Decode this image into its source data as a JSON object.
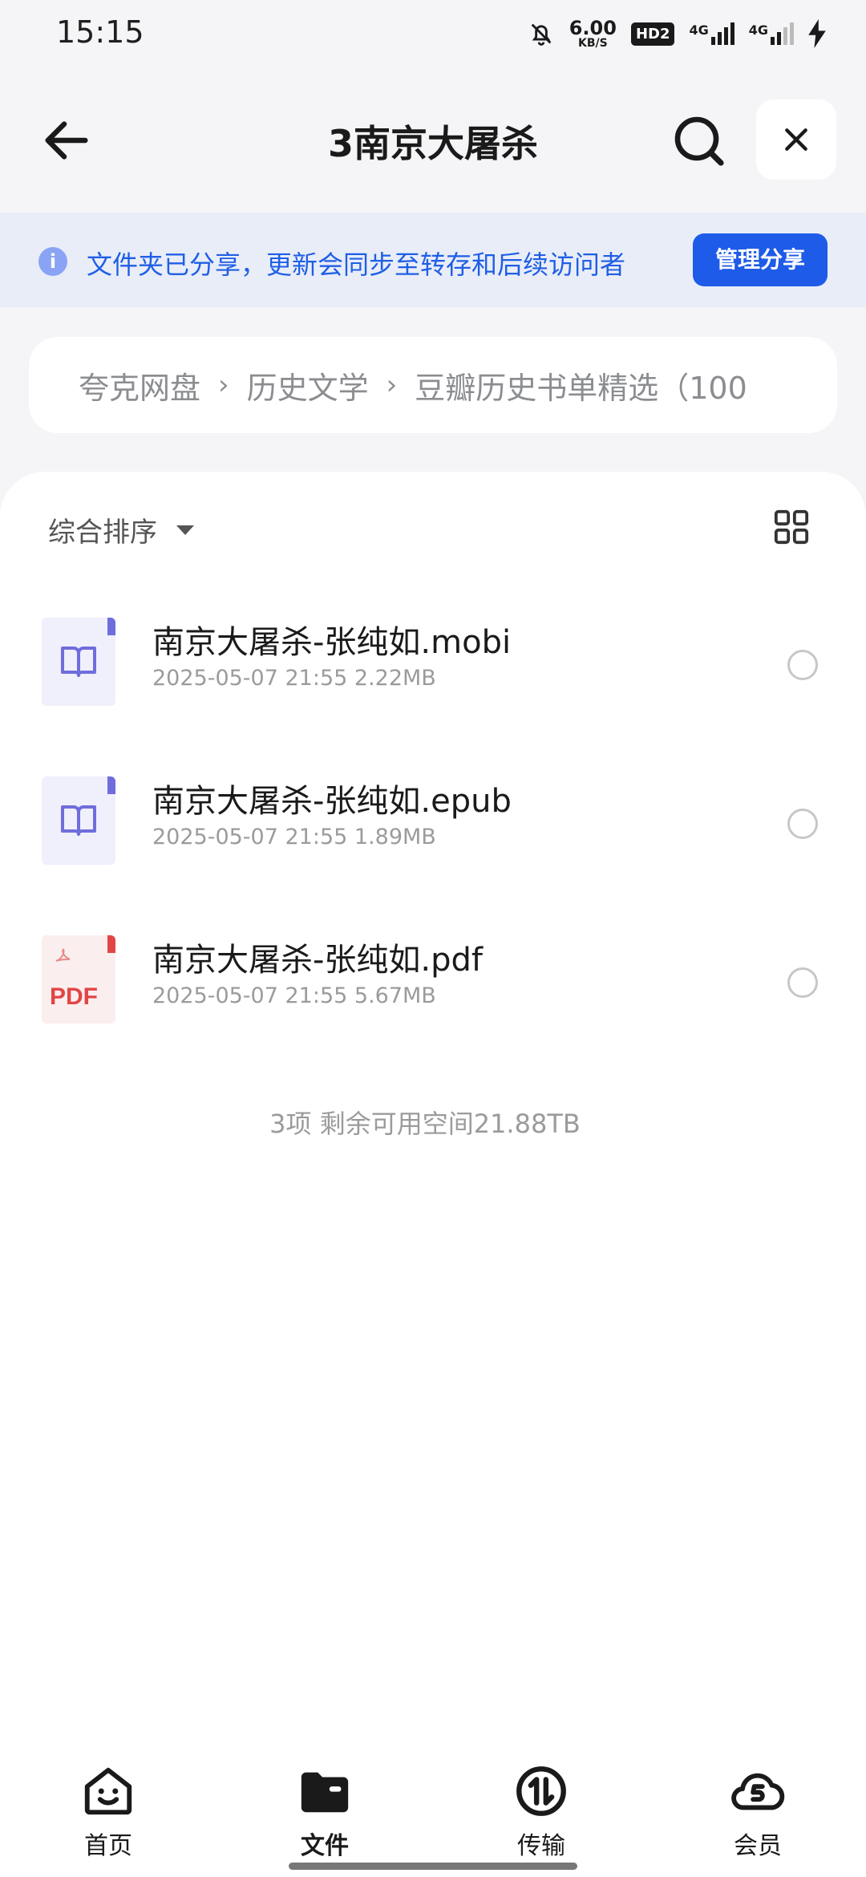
{
  "status": {
    "time": "15:15",
    "speed_value": "6.00",
    "speed_unit": "KB/S",
    "hd": "HD2",
    "net1": "4G",
    "net2": "4G"
  },
  "header": {
    "title": "3南京大屠杀"
  },
  "banner": {
    "info_icon": "i",
    "text": "文件夹已分享，更新会同步至转存和后续访问者",
    "button": "管理分享"
  },
  "breadcrumb": {
    "items": [
      "夸克网盘",
      "历史文学",
      "豆瓣历史书单精选（100"
    ],
    "separator": "›"
  },
  "toolbar": {
    "sort_label": "综合排序"
  },
  "files": [
    {
      "name": "南京大屠杀-张纯如.mobi",
      "meta": "2025-05-07 21:55  2.22MB",
      "icon": "book-file-icon"
    },
    {
      "name": "南京大屠杀-张纯如.epub",
      "meta": "2025-05-07 21:55  1.89MB",
      "icon": "book-file-icon"
    },
    {
      "name": "南京大屠杀-张纯如.pdf",
      "meta": "2025-05-07 21:55  5.67MB",
      "icon": "pdf-file-icon",
      "icon_text": "PDF"
    }
  ],
  "summary": "3项 剩余可用空间21.88TB",
  "nav": {
    "items": [
      {
        "label": "首页",
        "icon": "home-face-icon"
      },
      {
        "label": "文件",
        "icon": "folder-icon",
        "active": true
      },
      {
        "label": "传输",
        "icon": "transfer-icon"
      },
      {
        "label": "会员",
        "icon": "cloud-member-icon"
      }
    ]
  },
  "colors": {
    "accent": "#1e5be8",
    "banner_bg": "#e9edf8",
    "book_icon": "#6f6ddc",
    "pdf_icon": "#e14646"
  }
}
